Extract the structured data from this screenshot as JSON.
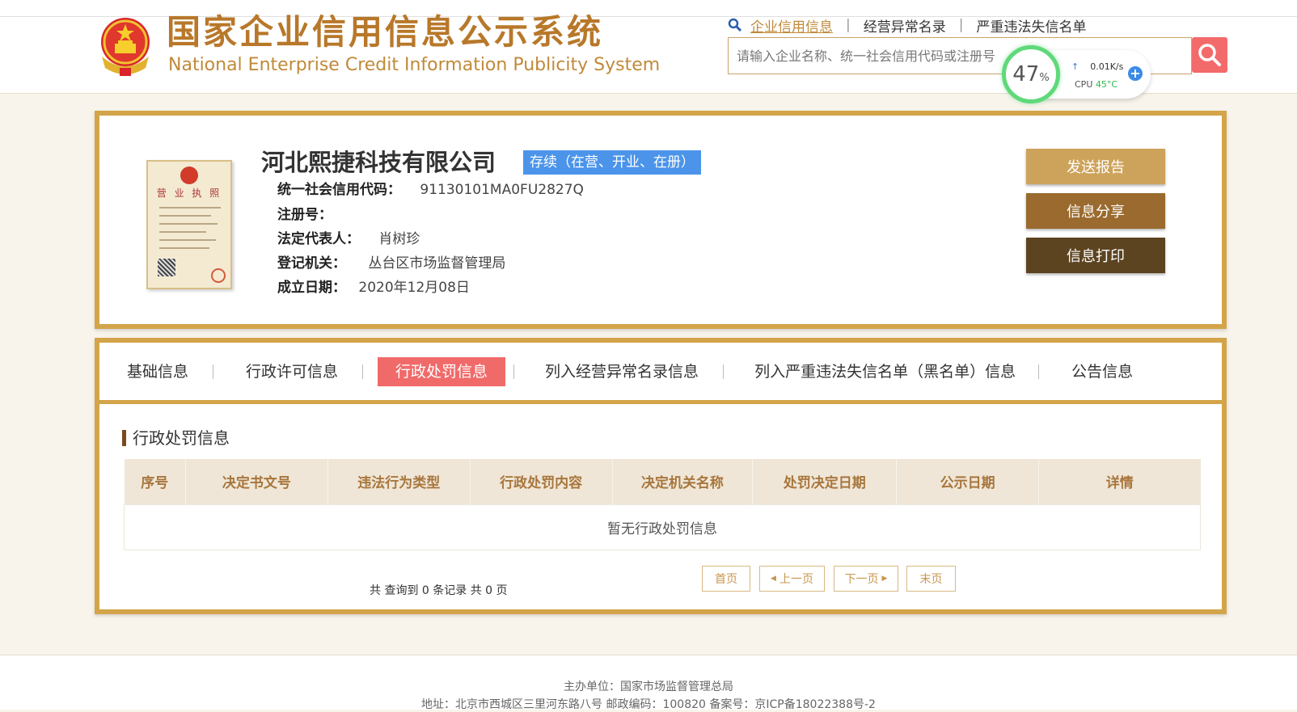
{
  "header": {
    "logo_cn": "国家企业信用信息公示系统",
    "logo_en": "National Enterprise Credit Information Publicity System",
    "links": [
      "企业信用信息",
      "经营异常名录",
      "严重违法失信名单"
    ],
    "search_placeholder": "请输入企业名称、统一社会信用代码或注册号"
  },
  "perf_widget": {
    "percent": "47",
    "percent_unit": "%",
    "net_speed": "0.01K/s",
    "cpu_label": "CPU",
    "cpu_temp": "45°C"
  },
  "company": {
    "name": "河北熙捷科技有限公司",
    "status": "存续（在营、开业、在册）",
    "credit_code_label": "统一社会信用代码：",
    "credit_code": "91130101MA0FU2827Q",
    "reg_no_label": "注册号：",
    "reg_no": "",
    "legal_rep_label": "法定代表人：",
    "legal_rep": "肖树珍",
    "authority_label": "登记机关：",
    "authority": "丛台区市场监督管理局",
    "established_label": "成立日期：",
    "established": "2020年12月08日",
    "license_title": "营 业 执 照"
  },
  "actions": {
    "send_report": "发送报告",
    "share": "信息分享",
    "print": "信息打印"
  },
  "tabs": [
    {
      "label": "基础信息"
    },
    {
      "label": "行政许可信息"
    },
    {
      "label": "行政处罚信息"
    },
    {
      "label": "列入经营异常名录信息"
    },
    {
      "label": "列入严重违法失信名单（黑名单）信息"
    },
    {
      "label": "公告信息"
    }
  ],
  "section": {
    "title": "行政处罚信息",
    "columns": [
      "序号",
      "决定书文号",
      "违法行为类型",
      "行政处罚内容",
      "决定机关名称",
      "处罚决定日期",
      "公示日期",
      "详情"
    ],
    "empty_text": "暂无行政处罚信息"
  },
  "pager": {
    "summary": "共 查询到 0 条记录 共 0 页",
    "first": "首页",
    "prev": "上一页",
    "next": "下一页",
    "last": "末页"
  },
  "footer": {
    "line1": "主办单位：国家市场监督管理总局",
    "line2": "地址：北京市西城区三里河东路八号   邮政编码：100820   备案号：京ICP备18022388号-2"
  },
  "colors": {
    "gold": "#d3a449",
    "active_tab": "#f16a6a",
    "status_badge": "#4b94ea"
  }
}
